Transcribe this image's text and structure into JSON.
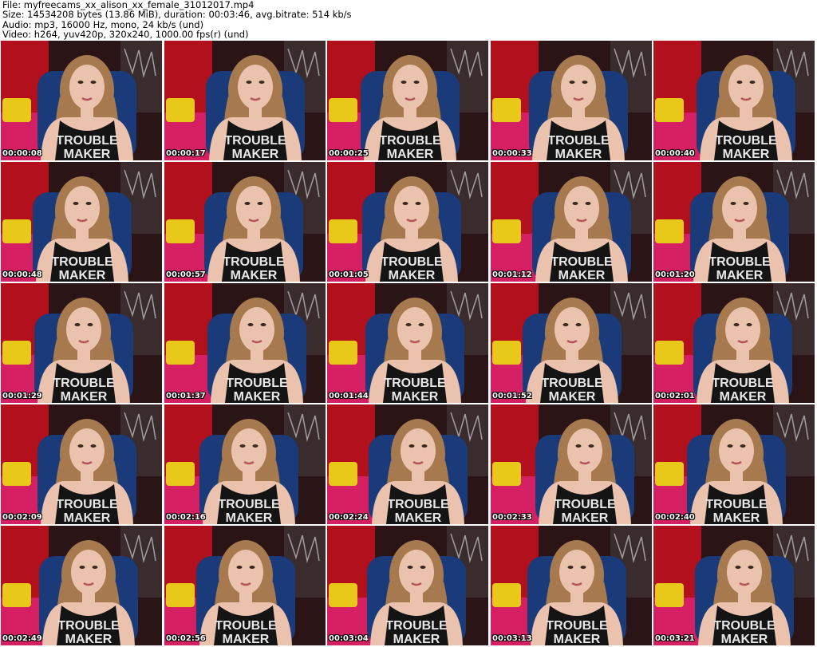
{
  "header": {
    "file_line": "File: myfreecams_xx_alison_xx_female_31012017.mp4",
    "size_line": "Size: 14534208 bytes (13.86 MiB), duration: 00:03:46, avg.bitrate: 514 kb/s",
    "audio_line": "Audio: mp3, 16000 Hz, mono, 24 kb/s (und)",
    "video_line": "Video: h264, yuv420p, 320x240, 1000.00 fps(r) (und)"
  },
  "shirt_text": [
    "TROUBLE",
    "MAKER"
  ],
  "thumbnails": [
    {
      "time": "00:00:08"
    },
    {
      "time": "00:00:17"
    },
    {
      "time": "00:00:25"
    },
    {
      "time": "00:00:33"
    },
    {
      "time": "00:00:40"
    },
    {
      "time": "00:00:48"
    },
    {
      "time": "00:00:57"
    },
    {
      "time": "00:01:05"
    },
    {
      "time": "00:01:12"
    },
    {
      "time": "00:01:20"
    },
    {
      "time": "00:01:29"
    },
    {
      "time": "00:01:37"
    },
    {
      "time": "00:01:44"
    },
    {
      "time": "00:01:52"
    },
    {
      "time": "00:02:01"
    },
    {
      "time": "00:02:09"
    },
    {
      "time": "00:02:16"
    },
    {
      "time": "00:02:24"
    },
    {
      "time": "00:02:33"
    },
    {
      "time": "00:02:40"
    },
    {
      "time": "00:02:49"
    },
    {
      "time": "00:02:56"
    },
    {
      "time": "00:03:04"
    },
    {
      "time": "00:03:13"
    },
    {
      "time": "00:03:21"
    }
  ],
  "colors": {
    "curtain": "#b3101e",
    "sofa": "#d41f63",
    "pillow": "#e8c91a",
    "chair": "#1a3a7a",
    "hair": "#a67a4e",
    "skin": "#eac2ad",
    "shirt": "#141414"
  }
}
